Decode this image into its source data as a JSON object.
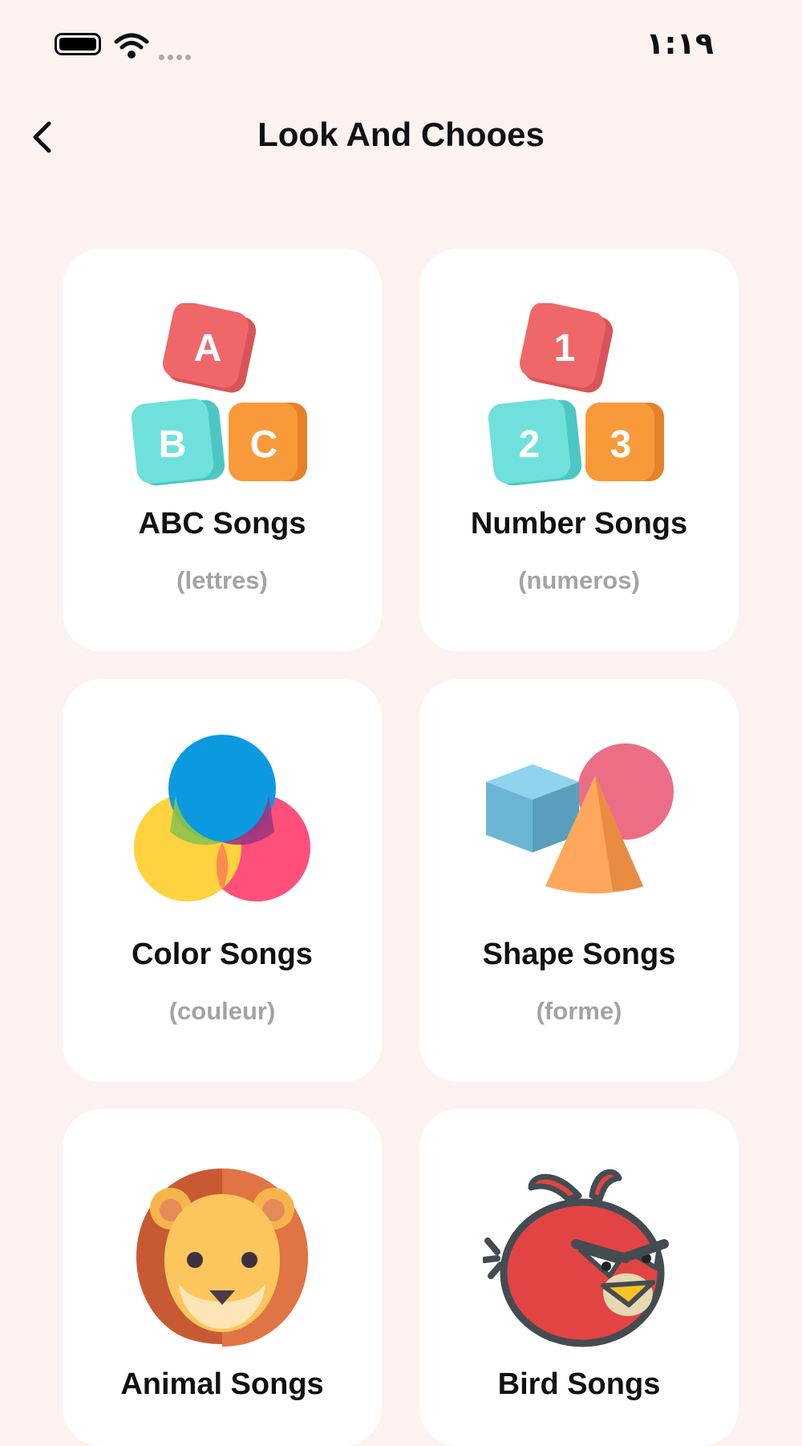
{
  "status_bar": {
    "time": "١:١٩"
  },
  "header": {
    "title": "Look And Chooes"
  },
  "categories": [
    {
      "title": "ABC Songs",
      "subtitle": "(lettres)",
      "icon": "abc-blocks-icon",
      "blocks": [
        "A",
        "B",
        "C"
      ]
    },
    {
      "title": "Number Songs",
      "subtitle": "(numeros)",
      "icon": "number-blocks-icon",
      "blocks": [
        "1",
        "2",
        "3"
      ]
    },
    {
      "title": "Color Songs",
      "subtitle": "(couleur)",
      "icon": "color-circles-icon"
    },
    {
      "title": "Shape Songs",
      "subtitle": "(forme)",
      "icon": "shapes-icon"
    },
    {
      "title": "Animal Songs",
      "subtitle": "",
      "icon": "lion-icon"
    },
    {
      "title": "Bird Songs",
      "subtitle": "",
      "icon": "red-bird-icon"
    }
  ],
  "colors": {
    "background": "#fcf3f1",
    "card": "#ffffff",
    "subtitle": "#a3a3a3",
    "block_red": "#f0676a",
    "block_teal": "#6fe0dc",
    "block_orange": "#f99a3a"
  }
}
